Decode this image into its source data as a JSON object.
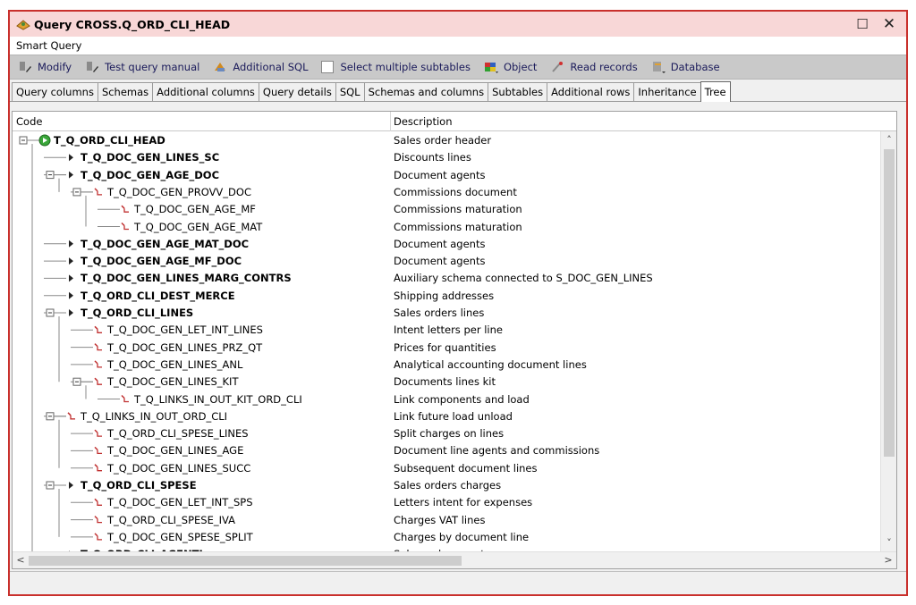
{
  "window": {
    "title": "Query CROSS.Q_ORD_CLI_HEAD",
    "subtitle": "Smart Query",
    "maximize_glyph": "☐",
    "close_glyph": "✕"
  },
  "toolbar": {
    "modify": "Modify",
    "test_query": "Test query manual",
    "additional_sql": "Additional SQL",
    "select_multiple": "Select multiple subtables",
    "object": "Object",
    "read_records": "Read records",
    "database": "Database"
  },
  "tabs": [
    "Query columns",
    "Schemas",
    "Additional columns",
    "Query details",
    "SQL",
    "Schemas and columns",
    "Subtables",
    "Additional rows",
    "Inheritance",
    "Tree"
  ],
  "active_tab": "Tree",
  "columns": {
    "code": "Code",
    "description": "Description"
  },
  "tree": [
    {
      "code": "T_Q_ORD_CLI_HEAD",
      "desc": "Sales order header",
      "level": 0,
      "bold": true,
      "icon": "play-icon",
      "expand": true
    },
    {
      "code": "T_Q_DOC_GEN_LINES_SC",
      "desc": "Discounts lines",
      "level": 1,
      "bold": true,
      "icon": "arrow-icon",
      "expand": false
    },
    {
      "code": "T_Q_DOC_GEN_AGE_DOC",
      "desc": "Document agents",
      "level": 1,
      "bold": true,
      "icon": "arrow-icon",
      "expand": true
    },
    {
      "code": "T_Q_DOC_GEN_PROVV_DOC",
      "desc": "Commissions document",
      "level": 2,
      "bold": false,
      "icon": "link-icon",
      "expand": true
    },
    {
      "code": "T_Q_DOC_GEN_AGE_MF",
      "desc": "Commissions maturation",
      "level": 3,
      "bold": false,
      "icon": "link-icon",
      "expand": false
    },
    {
      "code": "T_Q_DOC_GEN_AGE_MAT",
      "desc": "Commissions maturation",
      "level": 3,
      "bold": false,
      "icon": "link-icon",
      "expand": false
    },
    {
      "code": "T_Q_DOC_GEN_AGE_MAT_DOC",
      "desc": "Document agents",
      "level": 1,
      "bold": true,
      "icon": "arrow-icon",
      "expand": false
    },
    {
      "code": "T_Q_DOC_GEN_AGE_MF_DOC",
      "desc": "Document agents",
      "level": 1,
      "bold": true,
      "icon": "arrow-icon",
      "expand": false
    },
    {
      "code": "T_Q_DOC_GEN_LINES_MARG_CONTRS",
      "desc": "Auxiliary schema connected to S_DOC_GEN_LINES",
      "level": 1,
      "bold": true,
      "icon": "arrow-icon",
      "expand": false
    },
    {
      "code": "T_Q_ORD_CLI_DEST_MERCE",
      "desc": "Shipping addresses",
      "level": 1,
      "bold": true,
      "icon": "arrow-icon",
      "expand": false
    },
    {
      "code": "T_Q_ORD_CLI_LINES",
      "desc": "Sales orders lines",
      "level": 1,
      "bold": true,
      "icon": "arrow-icon",
      "expand": true
    },
    {
      "code": "T_Q_DOC_GEN_LET_INT_LINES",
      "desc": "Intent letters per line",
      "level": 2,
      "bold": false,
      "icon": "link-icon",
      "expand": false
    },
    {
      "code": "T_Q_DOC_GEN_LINES_PRZ_QT",
      "desc": "Prices for quantities",
      "level": 2,
      "bold": false,
      "icon": "link-icon",
      "expand": false
    },
    {
      "code": "T_Q_DOC_GEN_LINES_ANL",
      "desc": "Analytical accounting document lines",
      "level": 2,
      "bold": false,
      "icon": "link-icon",
      "expand": false
    },
    {
      "code": "T_Q_DOC_GEN_LINES_KIT",
      "desc": "Documents lines kit",
      "level": 2,
      "bold": false,
      "icon": "link-icon",
      "expand": true
    },
    {
      "code": "T_Q_LINKS_IN_OUT_KIT_ORD_CLI",
      "desc": "Link components and load",
      "level": 3,
      "bold": false,
      "icon": "link-icon",
      "expand": false
    },
    {
      "code": "T_Q_LINKS_IN_OUT_ORD_CLI",
      "desc": "Link future load unload",
      "level": 1,
      "bold": false,
      "icon": "link-icon",
      "expand": true
    },
    {
      "code": "T_Q_ORD_CLI_SPESE_LINES",
      "desc": "Split charges on lines",
      "level": 2,
      "bold": false,
      "icon": "link-icon",
      "expand": false
    },
    {
      "code": "T_Q_DOC_GEN_LINES_AGE",
      "desc": "Document line agents and commissions",
      "level": 2,
      "bold": false,
      "icon": "link-icon",
      "expand": false
    },
    {
      "code": "T_Q_DOC_GEN_LINES_SUCC",
      "desc": "Subsequent document lines",
      "level": 2,
      "bold": false,
      "icon": "link-icon",
      "expand": false
    },
    {
      "code": "T_Q_ORD_CLI_SPESE",
      "desc": "Sales orders charges",
      "level": 1,
      "bold": true,
      "icon": "arrow-icon",
      "expand": true
    },
    {
      "code": "T_Q_DOC_GEN_LET_INT_SPS",
      "desc": "Letters intent for expenses",
      "level": 2,
      "bold": false,
      "icon": "link-icon",
      "expand": false
    },
    {
      "code": "T_Q_ORD_CLI_SPESE_IVA",
      "desc": "Charges VAT lines",
      "level": 2,
      "bold": false,
      "icon": "link-icon",
      "expand": false
    },
    {
      "code": "T_Q_DOC_GEN_SPESE_SPLIT",
      "desc": "Charges by document line",
      "level": 2,
      "bold": false,
      "icon": "link-icon",
      "expand": false
    },
    {
      "code": "T_Q_ORD_CLI_AGENTI",
      "desc": "Sales order agents",
      "level": 1,
      "bold": true,
      "icon": "arrow-icon",
      "expand": false
    }
  ]
}
